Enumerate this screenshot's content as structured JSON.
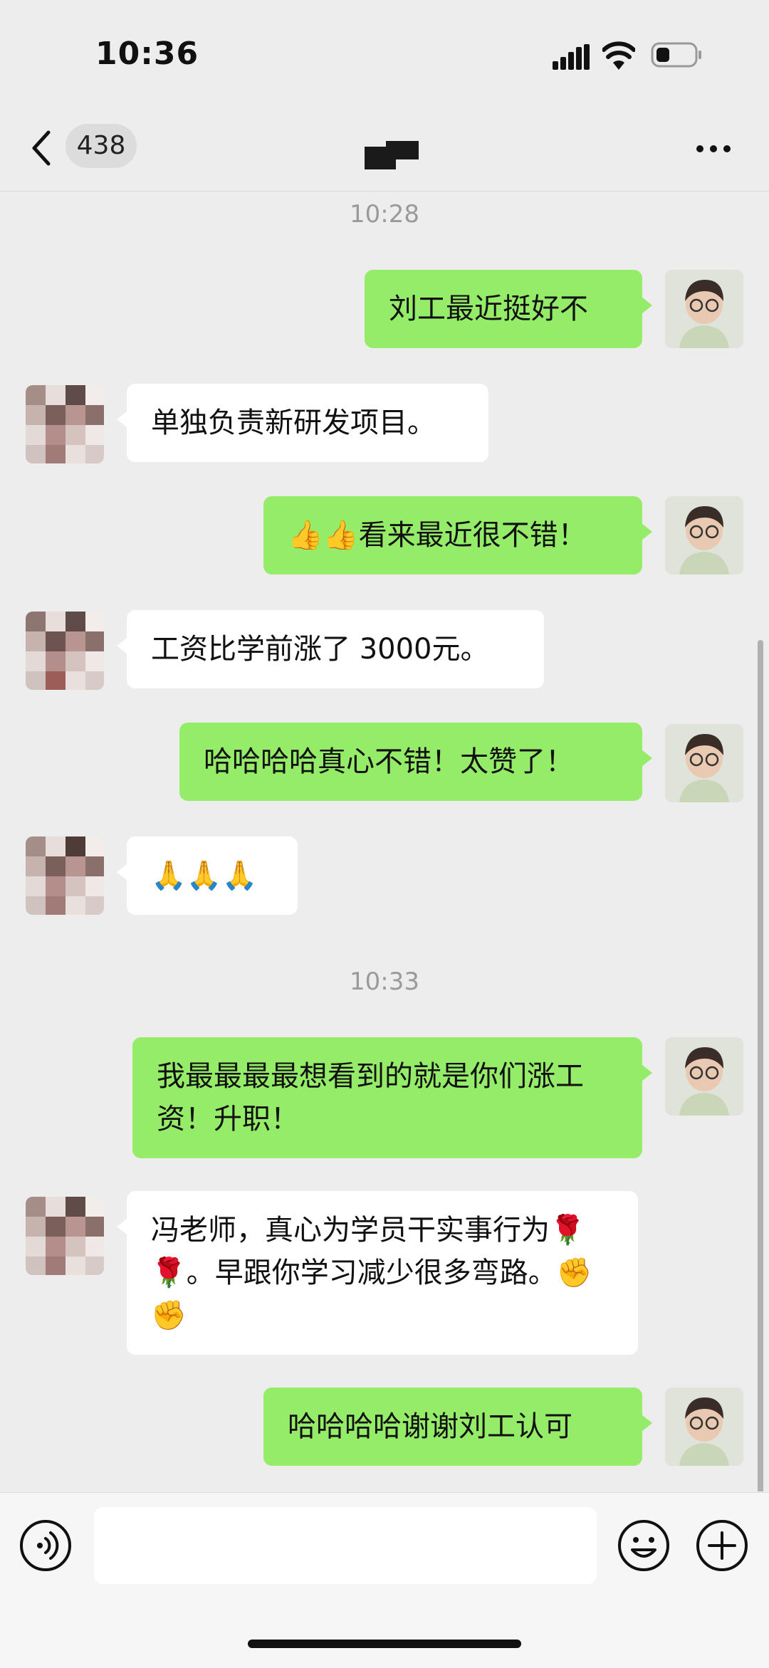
{
  "status_bar": {
    "time": "10:36"
  },
  "nav": {
    "unread_count": "438",
    "contact_name_redacted": true
  },
  "messages": [
    {
      "type": "timestamp",
      "text": "10:28"
    },
    {
      "type": "bubble",
      "side": "me",
      "text": "刘工最近挺好不"
    },
    {
      "type": "bubble",
      "side": "other",
      "text": "单独负责新研发项目。"
    },
    {
      "type": "bubble",
      "side": "me",
      "text": "👍👍看来最近很不错！"
    },
    {
      "type": "bubble",
      "side": "other",
      "text": "工资比学前涨了 3000元。"
    },
    {
      "type": "bubble",
      "side": "me",
      "text": "哈哈哈哈真心不错！太赞了！"
    },
    {
      "type": "bubble",
      "side": "other",
      "text": "🙏🙏🙏"
    },
    {
      "type": "timestamp",
      "text": "10:33"
    },
    {
      "type": "bubble",
      "side": "me",
      "text": "我最最最最想看到的就是你们涨工资！升职！"
    },
    {
      "type": "bubble",
      "side": "other",
      "text": "冯老师，真心为学员干实事行为🌹🌹。早跟你学习减少很多弯路。✊✊"
    },
    {
      "type": "bubble",
      "side": "me",
      "text": "哈哈哈哈谢谢刘工认可"
    }
  ],
  "input": {
    "placeholder": ""
  },
  "colors": {
    "bubble_me": "#95ec69",
    "bubble_other": "#ffffff",
    "background": "#ededed",
    "timestamp": "#9a9a9a"
  }
}
